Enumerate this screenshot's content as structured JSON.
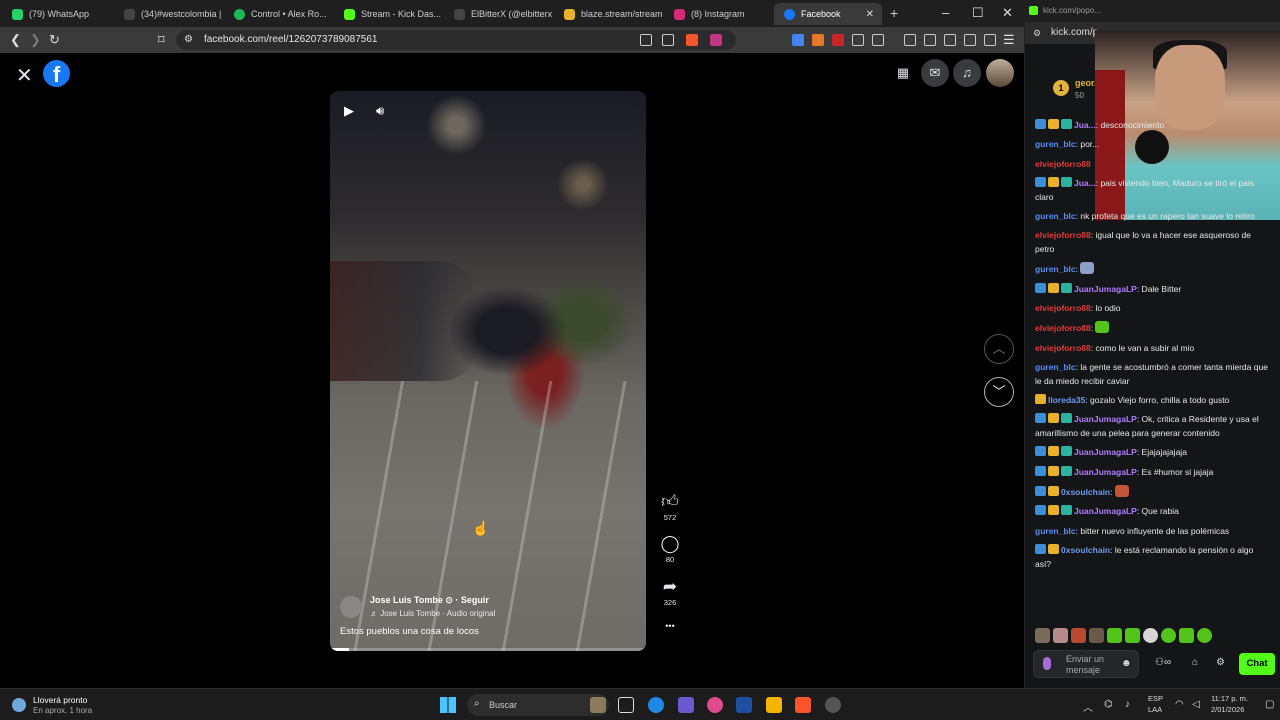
{
  "browser": {
    "tabs": [
      {
        "label": "(79) WhatsApp",
        "color": "#25d366"
      },
      {
        "label": "(34)#westcolombia | ...",
        "color": "#111111"
      },
      {
        "label": "Control • Alex Ro...",
        "color": "#1db954"
      },
      {
        "label": "Stream - Kick Das...",
        "color": "#53fc18"
      },
      {
        "label": "ElBitterX (@elbitterx)...",
        "color": "#111111"
      },
      {
        "label": "blaze.stream/stream...",
        "color": "#e8b12b"
      },
      {
        "label": "(8) Instagram",
        "color": "#d62976"
      },
      {
        "label": "Facebook",
        "color": "#1877f2"
      }
    ],
    "url": "facebook.com/reel/1262073789087561",
    "new_tab": "+",
    "close_tab": "✕"
  },
  "facebook": {
    "logo": "f",
    "video": {
      "author": "Jose Luis Tombe ⊙ · Seguir",
      "audio": "♬ Jose Luis Tombe · Audio original",
      "caption": "Estos pueblos una cosa de locos",
      "progress": 0.06
    },
    "actions": {
      "likes": "572",
      "comments": "80",
      "shares": "326",
      "more": "•••"
    }
  },
  "chat_panel": {
    "header_url": "kick.com/popo...",
    "url": "kick.com/p...",
    "leaderboard": {
      "rank": "1",
      "name": "geor...",
      "points": "50"
    },
    "messages": [
      {
        "user": "JuanJumagaLP",
        "color": "#b07cff",
        "badges": 3,
        "text": ": desconocimiento",
        "user_display": "Jua..."
      },
      {
        "user": "guren_blc",
        "color": "#5b8def",
        "badges": 0,
        "text": ": por..."
      },
      {
        "user": "elviejoforro88",
        "color": "#e03b3b",
        "badges": 0,
        "text": ""
      },
      {
        "user": "JuanJumagaLP",
        "color": "#b07cff",
        "badges": 3,
        "text": ": pais viviendo bien, Maduro se tiró el pais claro",
        "user_display": "Jua..."
      },
      {
        "user": "guren_blc",
        "color": "#5b8def",
        "badges": 0,
        "text": ": nk profeta que es un rapero tan suave lo retiro"
      },
      {
        "user": "elviejoforro88",
        "color": "#e03b3b",
        "badges": 0,
        "text": ": igual que lo va a hacer ese asqueroso de petro"
      },
      {
        "user": "guren_blc",
        "color": "#5b8def",
        "badges": 0,
        "text": ": ",
        "emote": "#8aa0c8"
      },
      {
        "user": "JuanJumagaLP",
        "color": "#b07cff",
        "badges": 3,
        "text": ": Dale Bitter"
      },
      {
        "user": "elviejoforro88",
        "color": "#e03b3b",
        "badges": 0,
        "text": ": lo odio"
      },
      {
        "user": "elviejoforro88",
        "color": "#e03b3b",
        "badges": 0,
        "text": ": ",
        "emote": "#53c41a"
      },
      {
        "user": "elviejoforro88",
        "color": "#e03b3b",
        "badges": 0,
        "text": ": como le van a subir al mio"
      },
      {
        "user": "guren_blc",
        "color": "#5b8def",
        "badges": 0,
        "text": ": la gente se acostumbró a comer tanta mierda que le da miedo recibir caviar"
      },
      {
        "user": "lloreda35",
        "color": "#6f9cf0",
        "badges": 1,
        "text": ": gozalo Viejo forro, chilla a todo gusto"
      },
      {
        "user": "JuanJumagaLP",
        "color": "#b07cff",
        "badges": 3,
        "text": ": Ok, critica a Residente y usa el amarillismo de una pelea para generar contenido"
      },
      {
        "user": "JuanJumagaLP",
        "color": "#b07cff",
        "badges": 3,
        "text": ": Ejajajajajaja"
      },
      {
        "user": "JuanJumagaLP",
        "color": "#b07cff",
        "badges": 3,
        "text": ": Es #humor si jajaja"
      },
      {
        "user": "0xsoulchain",
        "color": "#6f9cf0",
        "badges": 2,
        "text": ": ",
        "emote": "#c2543a"
      },
      {
        "user": "JuanJumagaLP",
        "color": "#b07cff",
        "badges": 3,
        "text": ": Que rabia"
      },
      {
        "user": "guren_blc",
        "color": "#5b8def",
        "badges": 0,
        "text": ": bitter nuevo influyente de las polémicas"
      },
      {
        "user": "0xsoulchain",
        "color": "#6f9cf0",
        "badges": 2,
        "text": ": le está reclamando la pensión o algo así?"
      }
    ],
    "input_placeholder": "Enviar un mensaje",
    "chat_button": "Chat"
  },
  "taskbar": {
    "weather_title": "Lloverá pronto",
    "weather_sub": "En aprox. 1 hora",
    "search": "Buscar",
    "lang1": "ESP",
    "lang2": "LAA",
    "time": "11:17 p. m.",
    "date": "2/01/2026"
  }
}
